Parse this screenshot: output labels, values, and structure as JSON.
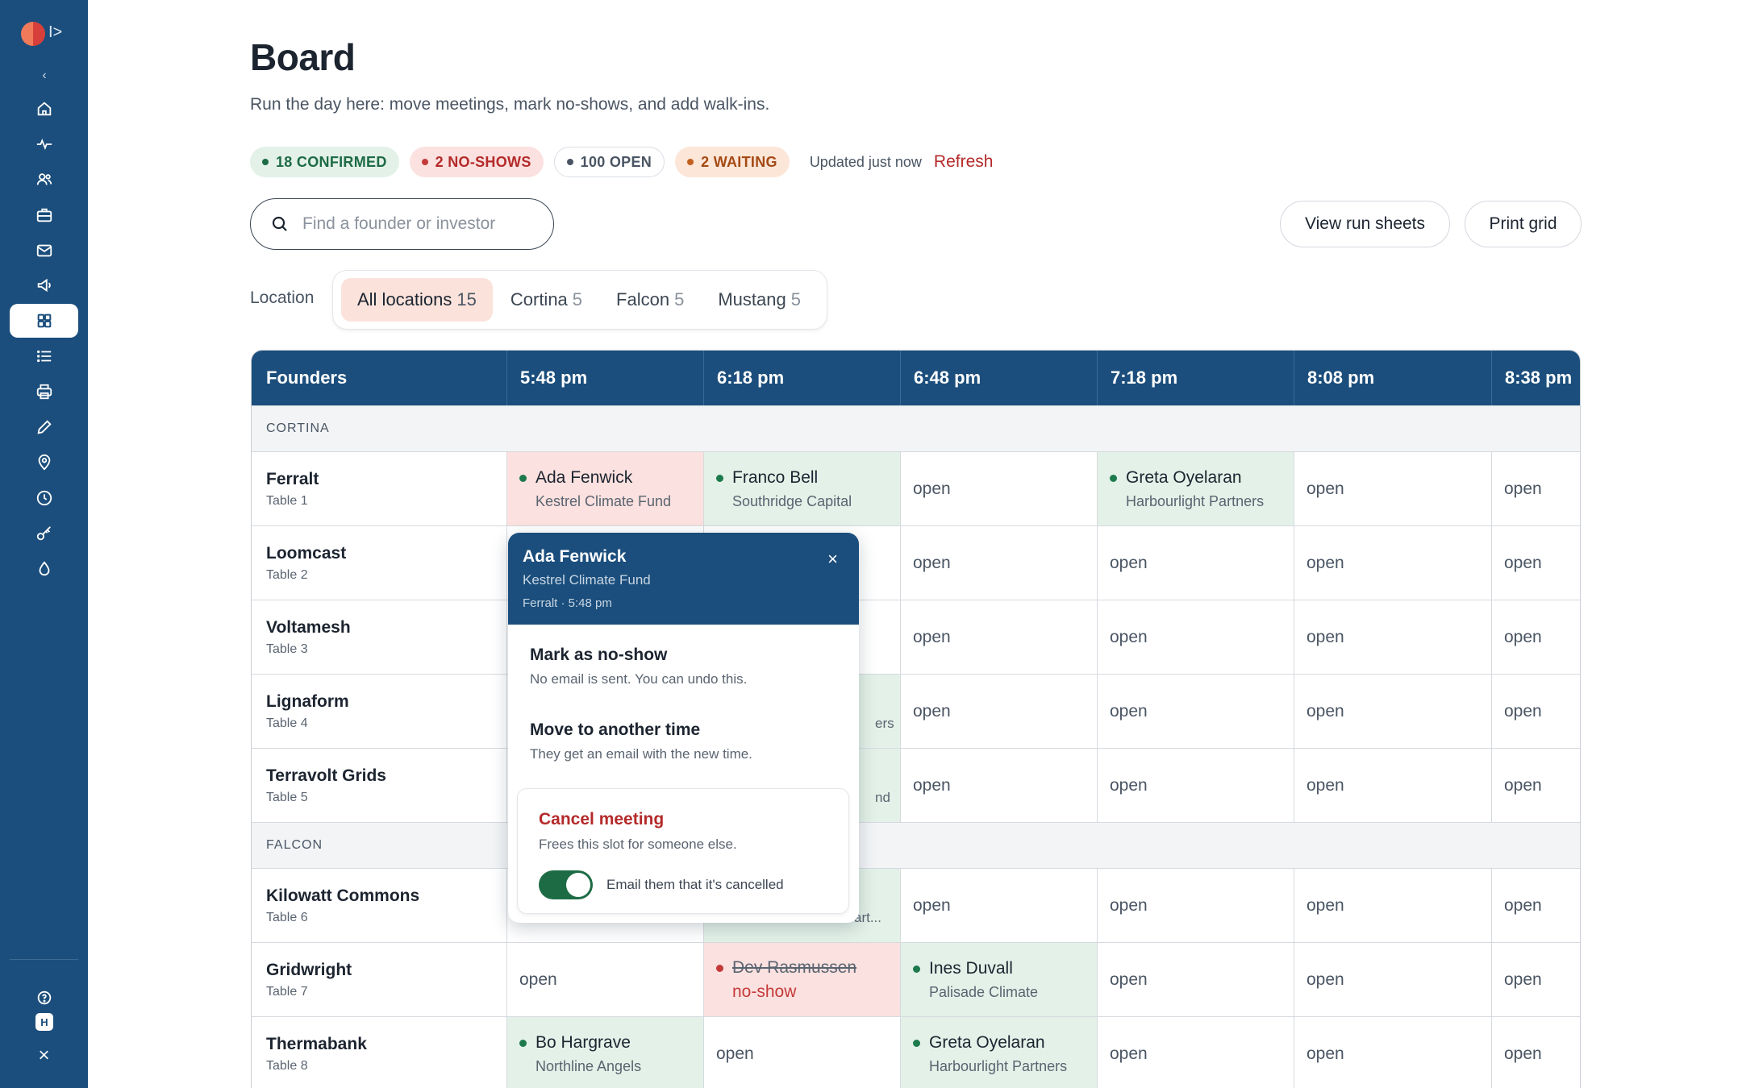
{
  "sidebar": {
    "expand_glyph": "I>",
    "collapse_glyph": "‹",
    "items": [
      {
        "icon": "home-icon",
        "active": false
      },
      {
        "icon": "activity-icon",
        "active": false
      },
      {
        "icon": "users-icon",
        "active": false
      },
      {
        "icon": "briefcase-icon",
        "active": false
      },
      {
        "icon": "mail-icon",
        "active": false
      },
      {
        "icon": "megaphone-icon",
        "active": false
      },
      {
        "icon": "board-grid-icon",
        "active": true
      },
      {
        "icon": "list-icon",
        "active": false
      },
      {
        "icon": "printer-icon",
        "active": false
      },
      {
        "icon": "pencil-icon",
        "active": false
      },
      {
        "icon": "location-pin-icon",
        "active": false
      },
      {
        "icon": "clock-icon",
        "active": false
      },
      {
        "icon": "key-icon",
        "active": false
      },
      {
        "icon": "droplet-icon",
        "active": false
      }
    ],
    "footer": {
      "help_icon": "help-icon",
      "user_initial": "H",
      "close_glyph": "×"
    }
  },
  "header": {
    "title": "Board",
    "subtitle": "Run the day here: move meetings, mark no-shows, and add walk-ins."
  },
  "status": {
    "confirmed": "18 CONFIRMED",
    "no_shows": "2 NO-SHOWS",
    "open": "100 OPEN",
    "waiting": "2 WAITING",
    "updated": "Updated just now",
    "refresh": "Refresh"
  },
  "search": {
    "placeholder": "Find a founder or investor",
    "value": ""
  },
  "actions": {
    "view_run_sheets": "View run sheets",
    "print_grid": "Print grid"
  },
  "location": {
    "label": "Location",
    "tabs": [
      {
        "label": "All locations",
        "count": "15",
        "active": true
      },
      {
        "label": "Cortina",
        "count": "5",
        "active": false
      },
      {
        "label": "Falcon",
        "count": "5",
        "active": false
      },
      {
        "label": "Mustang",
        "count": "5",
        "active": false
      }
    ]
  },
  "grid": {
    "first_column": "Founders",
    "times": [
      "5:48 pm",
      "6:18 pm",
      "6:48 pm",
      "7:18 pm",
      "8:08 pm",
      "8:38 pm"
    ],
    "open_label": "open",
    "sections": {
      "cortina": "CORTINA",
      "falcon": "FALCON"
    },
    "rows": [
      {
        "name": "Ferralt",
        "table": "Table 1"
      },
      {
        "name": "Loomcast",
        "table": "Table 2"
      },
      {
        "name": "Voltamesh",
        "table": "Table 3"
      },
      {
        "name": "Lignaform",
        "table": "Table 4"
      },
      {
        "name": "Terravolt Grids",
        "table": "Table 5"
      },
      {
        "name": "Kilowatt Commons",
        "table": "Table 6"
      },
      {
        "name": "Gridwright",
        "table": "Table 7"
      },
      {
        "name": "Thermabank",
        "table": "Table 8"
      }
    ],
    "meetings": {
      "ferralt_548": {
        "investor": "Ada Fenwick",
        "org": "Kestrel Climate Fund"
      },
      "ferralt_618": {
        "investor": "Franco Bell",
        "org": "Southridge Capital"
      },
      "ferralt_718": {
        "investor": "Greta Oyelaran",
        "org": "Harbourlight Partners"
      },
      "gridwright_618": {
        "investor": "Dev Rasmussen",
        "status": "no-show"
      },
      "gridwright_648": {
        "investor": "Ines Duvall",
        "org": "Palisade Climate"
      },
      "thermabank_548": {
        "investor": "Bo Hargrave",
        "org": "Northline Angels"
      },
      "thermabank_648": {
        "investor": "Greta Oyelaran",
        "org": "Harbourlight Partners"
      }
    },
    "obscured_fragments": {
      "lignaform": "ers",
      "terravolt": "nd",
      "kilowatt": "art..."
    }
  },
  "popover": {
    "investor": "Ada Fenwick",
    "org": "Kestrel Climate Fund",
    "meta": "Ferralt · 5:48 pm",
    "close": "×",
    "options": [
      {
        "title": "Mark as no-show",
        "desc": "No email is sent. You can undo this."
      },
      {
        "title": "Move to another time",
        "desc": "They get an email with the new time."
      }
    ],
    "cancel": {
      "title": "Cancel meeting",
      "desc": "Frees this slot for someone else.",
      "toggle_label": "Email them that it's cancelled",
      "toggle_on": true
    }
  },
  "colors": {
    "brand_navy": "#1b4e7c",
    "confirmed_green": "#1d6b45",
    "no_show_red": "#c43a3a",
    "waiting_orange": "#c2611f",
    "active_tab_bg": "#fbe3dc"
  }
}
